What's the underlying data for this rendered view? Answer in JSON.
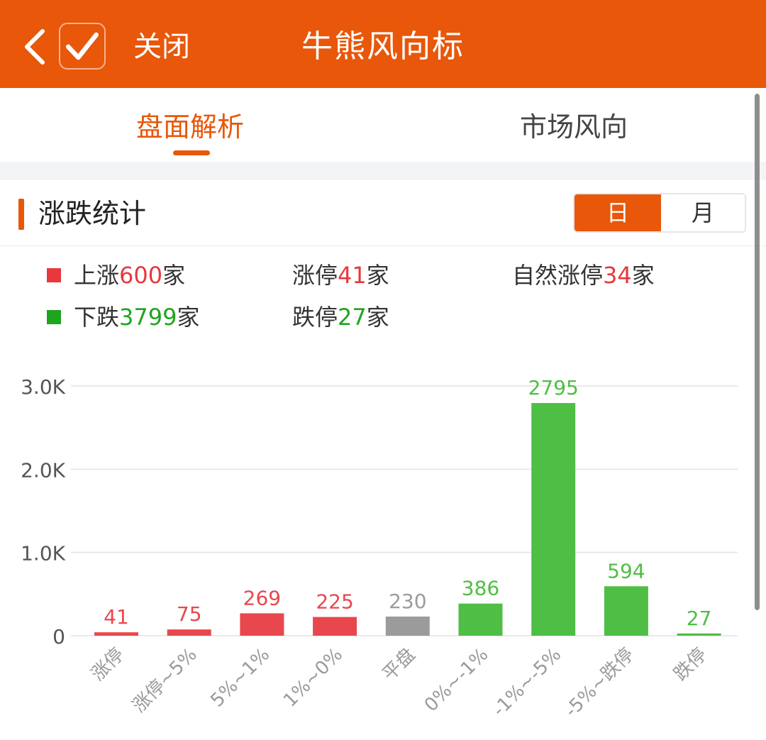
{
  "header": {
    "close_label": "关闭",
    "title": "牛熊风向标",
    "bg_color": "#e8570a",
    "icons": [
      "chevron-left-icon",
      "check-icon"
    ]
  },
  "tabs": [
    {
      "label": "盘面解析",
      "active": true
    },
    {
      "label": "市场风向",
      "active": false
    }
  ],
  "section": {
    "title": "涨跌统计",
    "period_options": [
      {
        "label": "日",
        "selected": true
      },
      {
        "label": "月",
        "selected": false
      }
    ]
  },
  "stats": {
    "rise": {
      "prefix": "上涨",
      "value": "600",
      "suffix": "家"
    },
    "fall": {
      "prefix": "下跌",
      "value": "3799",
      "suffix": "家"
    },
    "limit_up": {
      "prefix": "涨停",
      "value": "41",
      "suffix": "家"
    },
    "limit_down": {
      "prefix": "跌停",
      "value": "27",
      "suffix": "家"
    },
    "natural_limit_up": {
      "prefix": "自然涨停",
      "value": "34",
      "suffix": "家"
    }
  },
  "colors": {
    "accent": "#e8570a",
    "up": "#e8383d",
    "down": "#1ea51e",
    "up_bar": "#e8474d",
    "down_bar": "#4fbe44",
    "flat_bar": "#9b9b9b"
  },
  "chart_data": {
    "type": "bar",
    "categories": [
      "涨停",
      "涨停~5%",
      "5%~1%",
      "1%~0%",
      "平盘",
      "0%~-1%",
      "-1%~-5%",
      "-5%~跌停",
      "跌停"
    ],
    "values": [
      41,
      75,
      269,
      225,
      230,
      386,
      2795,
      594,
      27
    ],
    "value_labels": [
      "41",
      "75",
      "269",
      "225",
      "230",
      "386",
      "2795",
      "594",
      "27"
    ],
    "bar_colors": [
      "up",
      "up",
      "up",
      "up",
      "flat",
      "down",
      "down",
      "down",
      "down"
    ],
    "yticks": [
      0,
      1000,
      2000,
      3000
    ],
    "ytick_labels": [
      "0",
      "1.0K",
      "2.0K",
      "3.0K"
    ],
    "ylim": [
      0,
      3000
    ],
    "grid": true,
    "title": "",
    "xlabel": "",
    "ylabel": ""
  }
}
